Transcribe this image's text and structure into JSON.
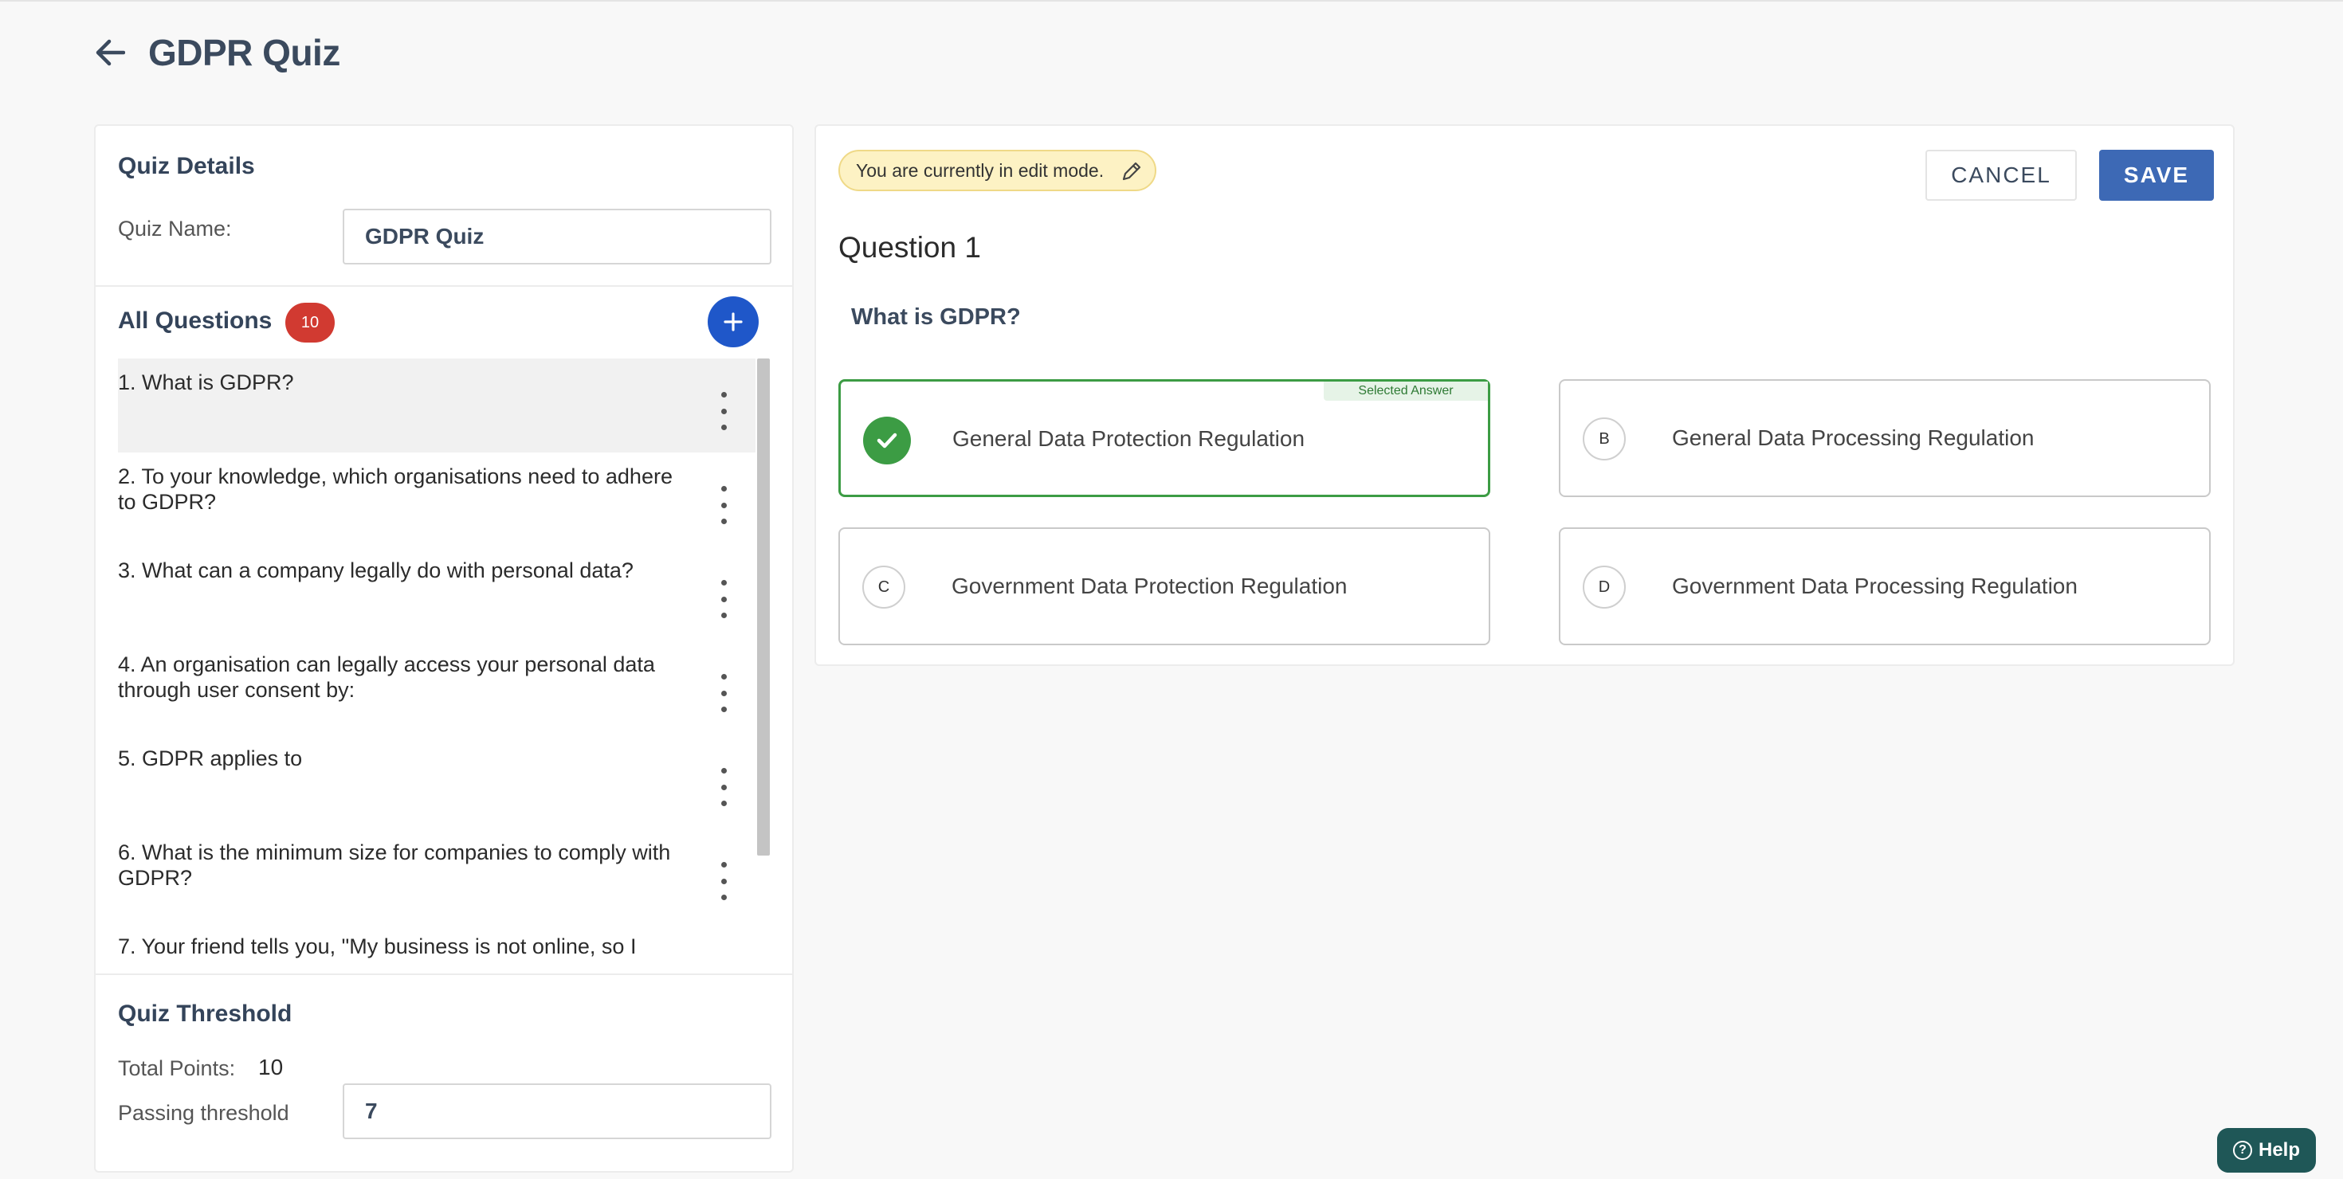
{
  "page": {
    "title": "GDPR Quiz"
  },
  "quiz_details": {
    "title": "Quiz Details",
    "name_label": "Quiz Name:",
    "name_value": "GDPR Quiz"
  },
  "questions_list": {
    "title": "All Questions",
    "count": "10",
    "items": [
      {
        "label": "1. What is GDPR?"
      },
      {
        "label": "2. To your knowledge, which organisations need to adhere to GDPR?"
      },
      {
        "label": "3. What can a company legally do with personal data?"
      },
      {
        "label": "4. An organisation can legally access your personal data through user consent by:"
      },
      {
        "label": "5. GDPR applies to"
      },
      {
        "label": "6. What is the minimum size for companies to comply with GDPR?"
      },
      {
        "label": "7. Your friend tells you, \"My business is not online, so I"
      }
    ]
  },
  "threshold": {
    "title": "Quiz Threshold",
    "total_label": "Total Points:",
    "total_value": "10",
    "passing_label": "Passing threshold",
    "passing_value": "7"
  },
  "editor": {
    "edit_mode_text": "You are currently in edit mode.",
    "cancel_label": "CANCEL",
    "save_label": "SAVE",
    "question_heading": "Question 1",
    "question_text": "What is GDPR?",
    "selected_tag": "Selected Answer",
    "answers": [
      {
        "letter": "A",
        "text": "General Data Protection Regulation",
        "selected": true
      },
      {
        "letter": "B",
        "text": "General Data Processing Regulation",
        "selected": false
      },
      {
        "letter": "C",
        "text": "Government Data Protection Regulation",
        "selected": false
      },
      {
        "letter": "D",
        "text": "Government Data Processing Regulation",
        "selected": false
      }
    ]
  },
  "help": {
    "label": "Help"
  },
  "colors": {
    "accent_blue": "#3d69b5",
    "add_button": "#1f57c9",
    "badge_red": "#d13a31",
    "selected_green": "#3c9c44",
    "edit_badge_bg": "#fdf2c4",
    "help_bg": "#1f5757"
  },
  "icons": [
    "back-arrow-icon",
    "plus-icon",
    "kebab-menu-icon",
    "pencil-icon",
    "checkmark-icon",
    "help-circle-icon"
  ]
}
